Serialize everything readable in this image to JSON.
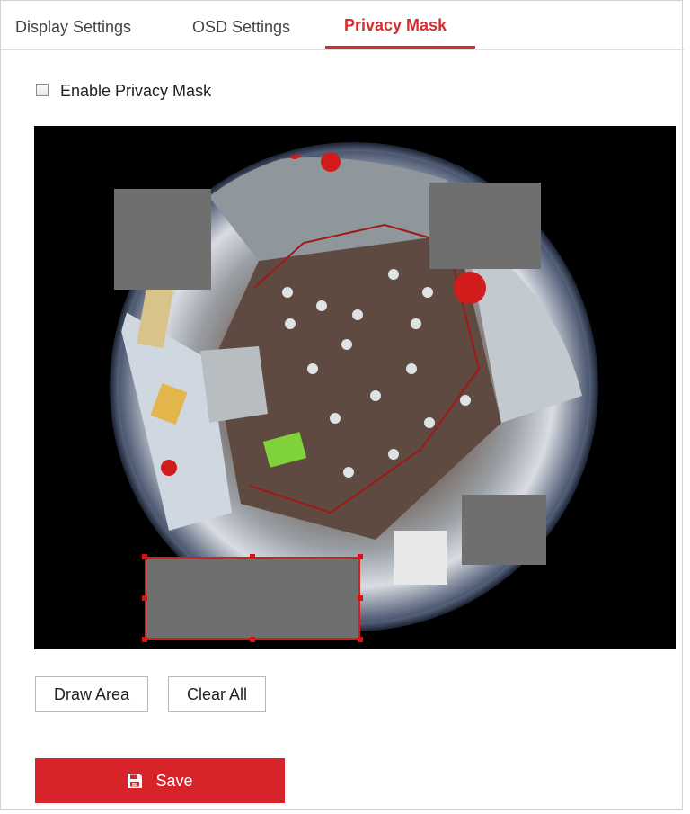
{
  "tabs": [
    {
      "label": "Display Settings",
      "active": false
    },
    {
      "label": "OSD Settings",
      "active": false
    },
    {
      "label": "Privacy Mask",
      "active": true
    }
  ],
  "enable_privacy_mask": {
    "label": "Enable Privacy Mask",
    "checked": false
  },
  "buttons": {
    "draw_area": "Draw Area",
    "clear_all": "Clear All",
    "save": "Save"
  },
  "icons": {
    "save": "floppy-disk-icon"
  },
  "colors": {
    "accent": "#d32f2f",
    "save_button": "#d9232a",
    "mask_fill": "#6f6f6f",
    "selection_border": "#d51e1e"
  }
}
